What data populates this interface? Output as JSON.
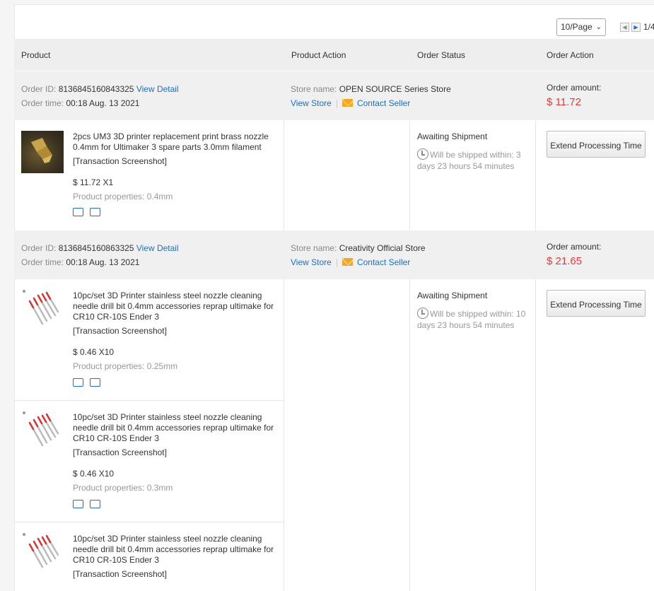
{
  "pager": {
    "page_size": "10/Page",
    "page_indicator": "1/4"
  },
  "table_headers": {
    "product": "Product",
    "product_action": "Product Action",
    "order_status": "Order Status",
    "order_action": "Order Action"
  },
  "orders": [
    {
      "order_id_label": "Order ID:",
      "order_id": "8136845160843325",
      "view_detail": "View Detail",
      "order_time_label": "Order time:",
      "order_time": "00:18 Aug. 13 2021",
      "store_label": "Store name:",
      "store_name": "OPEN SOURCE Series Store",
      "view_store": "View Store",
      "contact_seller": "Contact Seller",
      "amount_label": "Order amount:",
      "amount": "$ 11.72",
      "status": "Awaiting Shipment",
      "ship_text": "Will be shipped within: 3 days 23 hours 54 minutes",
      "action_button": "Extend Processing Time",
      "items": [
        {
          "title": "2pcs UM3 3D printer replacement print brass nozzle 0.4mm for Ultimaker 3 spare parts 3.0mm filament",
          "screenshot_link": "[Transaction Screenshot]",
          "price_qty": "$ 11.72 X1",
          "properties": "Product properties: 0.4mm"
        }
      ]
    },
    {
      "order_id_label": "Order ID:",
      "order_id": "8136845160863325",
      "view_detail": "View Detail",
      "order_time_label": "Order time:",
      "order_time": "00:18 Aug. 13 2021",
      "store_label": "Store name:",
      "store_name": "Creativity Official Store",
      "view_store": "View Store",
      "contact_seller": "Contact Seller",
      "amount_label": "Order amount:",
      "amount": "$ 21.65",
      "status": "Awaiting Shipment",
      "ship_text": "Will be shipped within: 10 days 23 hours 54 minutes",
      "action_button": "Extend Processing Time",
      "items": [
        {
          "title": "10pc/set 3D Printer stainless steel nozzle cleaning needle drill bit 0.4mm accessories reprap ultimake for CR10 CR-10S Ender 3",
          "screenshot_link": "[Transaction Screenshot]",
          "price_qty": "$ 0.46 X10",
          "properties": "Product properties: 0.25mm"
        },
        {
          "title": "10pc/set 3D Printer stainless steel nozzle cleaning needle drill bit 0.4mm accessories reprap ultimake for CR10 CR-10S Ender 3",
          "screenshot_link": "[Transaction Screenshot]",
          "price_qty": "$ 0.46 X10",
          "properties": "Product properties: 0.3mm"
        },
        {
          "title": "10pc/set 3D Printer stainless steel nozzle cleaning needle drill bit 0.4mm accessories reprap ultimake for CR10 CR-10S Ender 3",
          "screenshot_link": "[Transaction Screenshot]"
        }
      ]
    }
  ]
}
